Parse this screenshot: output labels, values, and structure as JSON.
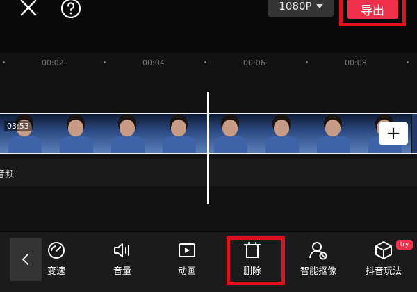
{
  "top_bar": {
    "resolution": "1080P",
    "export_label": "导出"
  },
  "timeline": {
    "ticks": [
      "00:02",
      "00:04",
      "00:06",
      "00:08"
    ],
    "clip_duration": "03:53",
    "add_clip_label": "+",
    "audio_label": "音频"
  },
  "toolbar": {
    "items": [
      {
        "label": "变速",
        "icon": "speed-icon"
      },
      {
        "label": "音量",
        "icon": "volume-icon"
      },
      {
        "label": "动画",
        "icon": "animation-icon"
      },
      {
        "label": "删除",
        "icon": "delete-icon"
      },
      {
        "label": "智能抠像",
        "icon": "smart-cutout-icon"
      },
      {
        "label": "抖音玩法",
        "icon": "douyin-effects-icon"
      }
    ],
    "badge": "try"
  },
  "colors": {
    "accent": "#f0304a",
    "highlight_box": "#e0101c",
    "background": "#0a0a0a"
  }
}
